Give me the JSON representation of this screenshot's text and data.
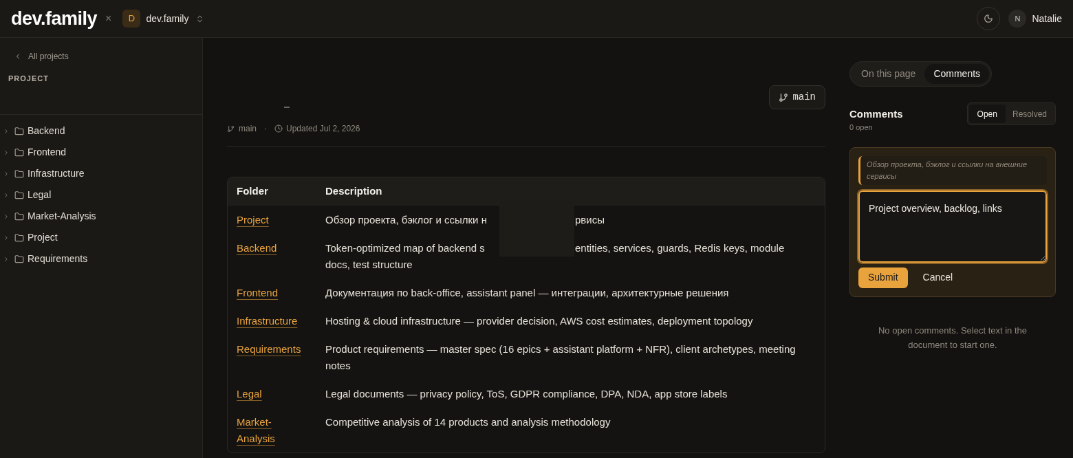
{
  "topbar": {
    "logo": "dev.family",
    "separator": "×",
    "workspace": {
      "initial": "D",
      "name": "dev.family"
    },
    "user": {
      "initial": "N",
      "name": "Natalie"
    }
  },
  "sidebar": {
    "back_link": "All projects",
    "section_label": "PROJECT",
    "items": [
      {
        "label": "Backend",
        "expanded": false
      },
      {
        "label": "Frontend",
        "expanded": false
      },
      {
        "label": "Infrastructure",
        "expanded": false
      },
      {
        "label": "Legal",
        "expanded": false
      },
      {
        "label": "Market-Analysis",
        "expanded": false
      },
      {
        "label": "Project",
        "expanded": false
      },
      {
        "label": "Requirements",
        "expanded": false
      }
    ]
  },
  "document": {
    "branch_button": "main",
    "meta": {
      "branch": "main",
      "separator": "·",
      "updated": "Updated Jul 2, 2026"
    },
    "table": {
      "columns": [
        "Folder",
        "Description"
      ],
      "rows": [
        {
          "folder": "Project",
          "description": [
            "Обзор проекта, бэклог и ссылки н",
            "рвисы"
          ]
        },
        {
          "folder": "Backend",
          "description": [
            "Token-optimized map of backend s",
            "entities, services, guards, Redis keys, module docs, test structure"
          ]
        },
        {
          "folder": "Frontend",
          "description": [
            "Документация по back-office, assistant panel — интеграции, архитектурные решения"
          ]
        },
        {
          "folder": "Infrastructure",
          "description": [
            "Hosting & cloud infrastructure — provider decision, AWS cost estimates, deployment topology"
          ]
        },
        {
          "folder": "Requirements",
          "description": [
            "Product requirements — master spec (16 epics + assistant platform + NFR), client archetypes, meeting notes"
          ]
        },
        {
          "folder": "Legal",
          "description": [
            "Legal documents — privacy policy, ToS, GDPR compliance, DPA, NDA, app store labels"
          ]
        },
        {
          "folder": "Market-Analysis",
          "description": [
            "Competitive analysis of 14 products and analysis methodology"
          ]
        }
      ]
    }
  },
  "comments_panel": {
    "tabs": [
      {
        "label": "On this page",
        "selected": false
      },
      {
        "label": "Comments",
        "selected": true
      }
    ],
    "heading": "Comments",
    "count": "0 open",
    "filters": [
      {
        "label": "Open",
        "selected": true
      },
      {
        "label": "Resolved",
        "selected": false
      }
    ],
    "draft": {
      "quote": "Обзор проекта, бэклог и ссылки на внешние сервисы",
      "value": "Project overview, backlog, links",
      "focused": true,
      "submit": "Submit",
      "cancel": "Cancel"
    },
    "empty_state": "No open comments. Select text in the document to start one."
  }
}
